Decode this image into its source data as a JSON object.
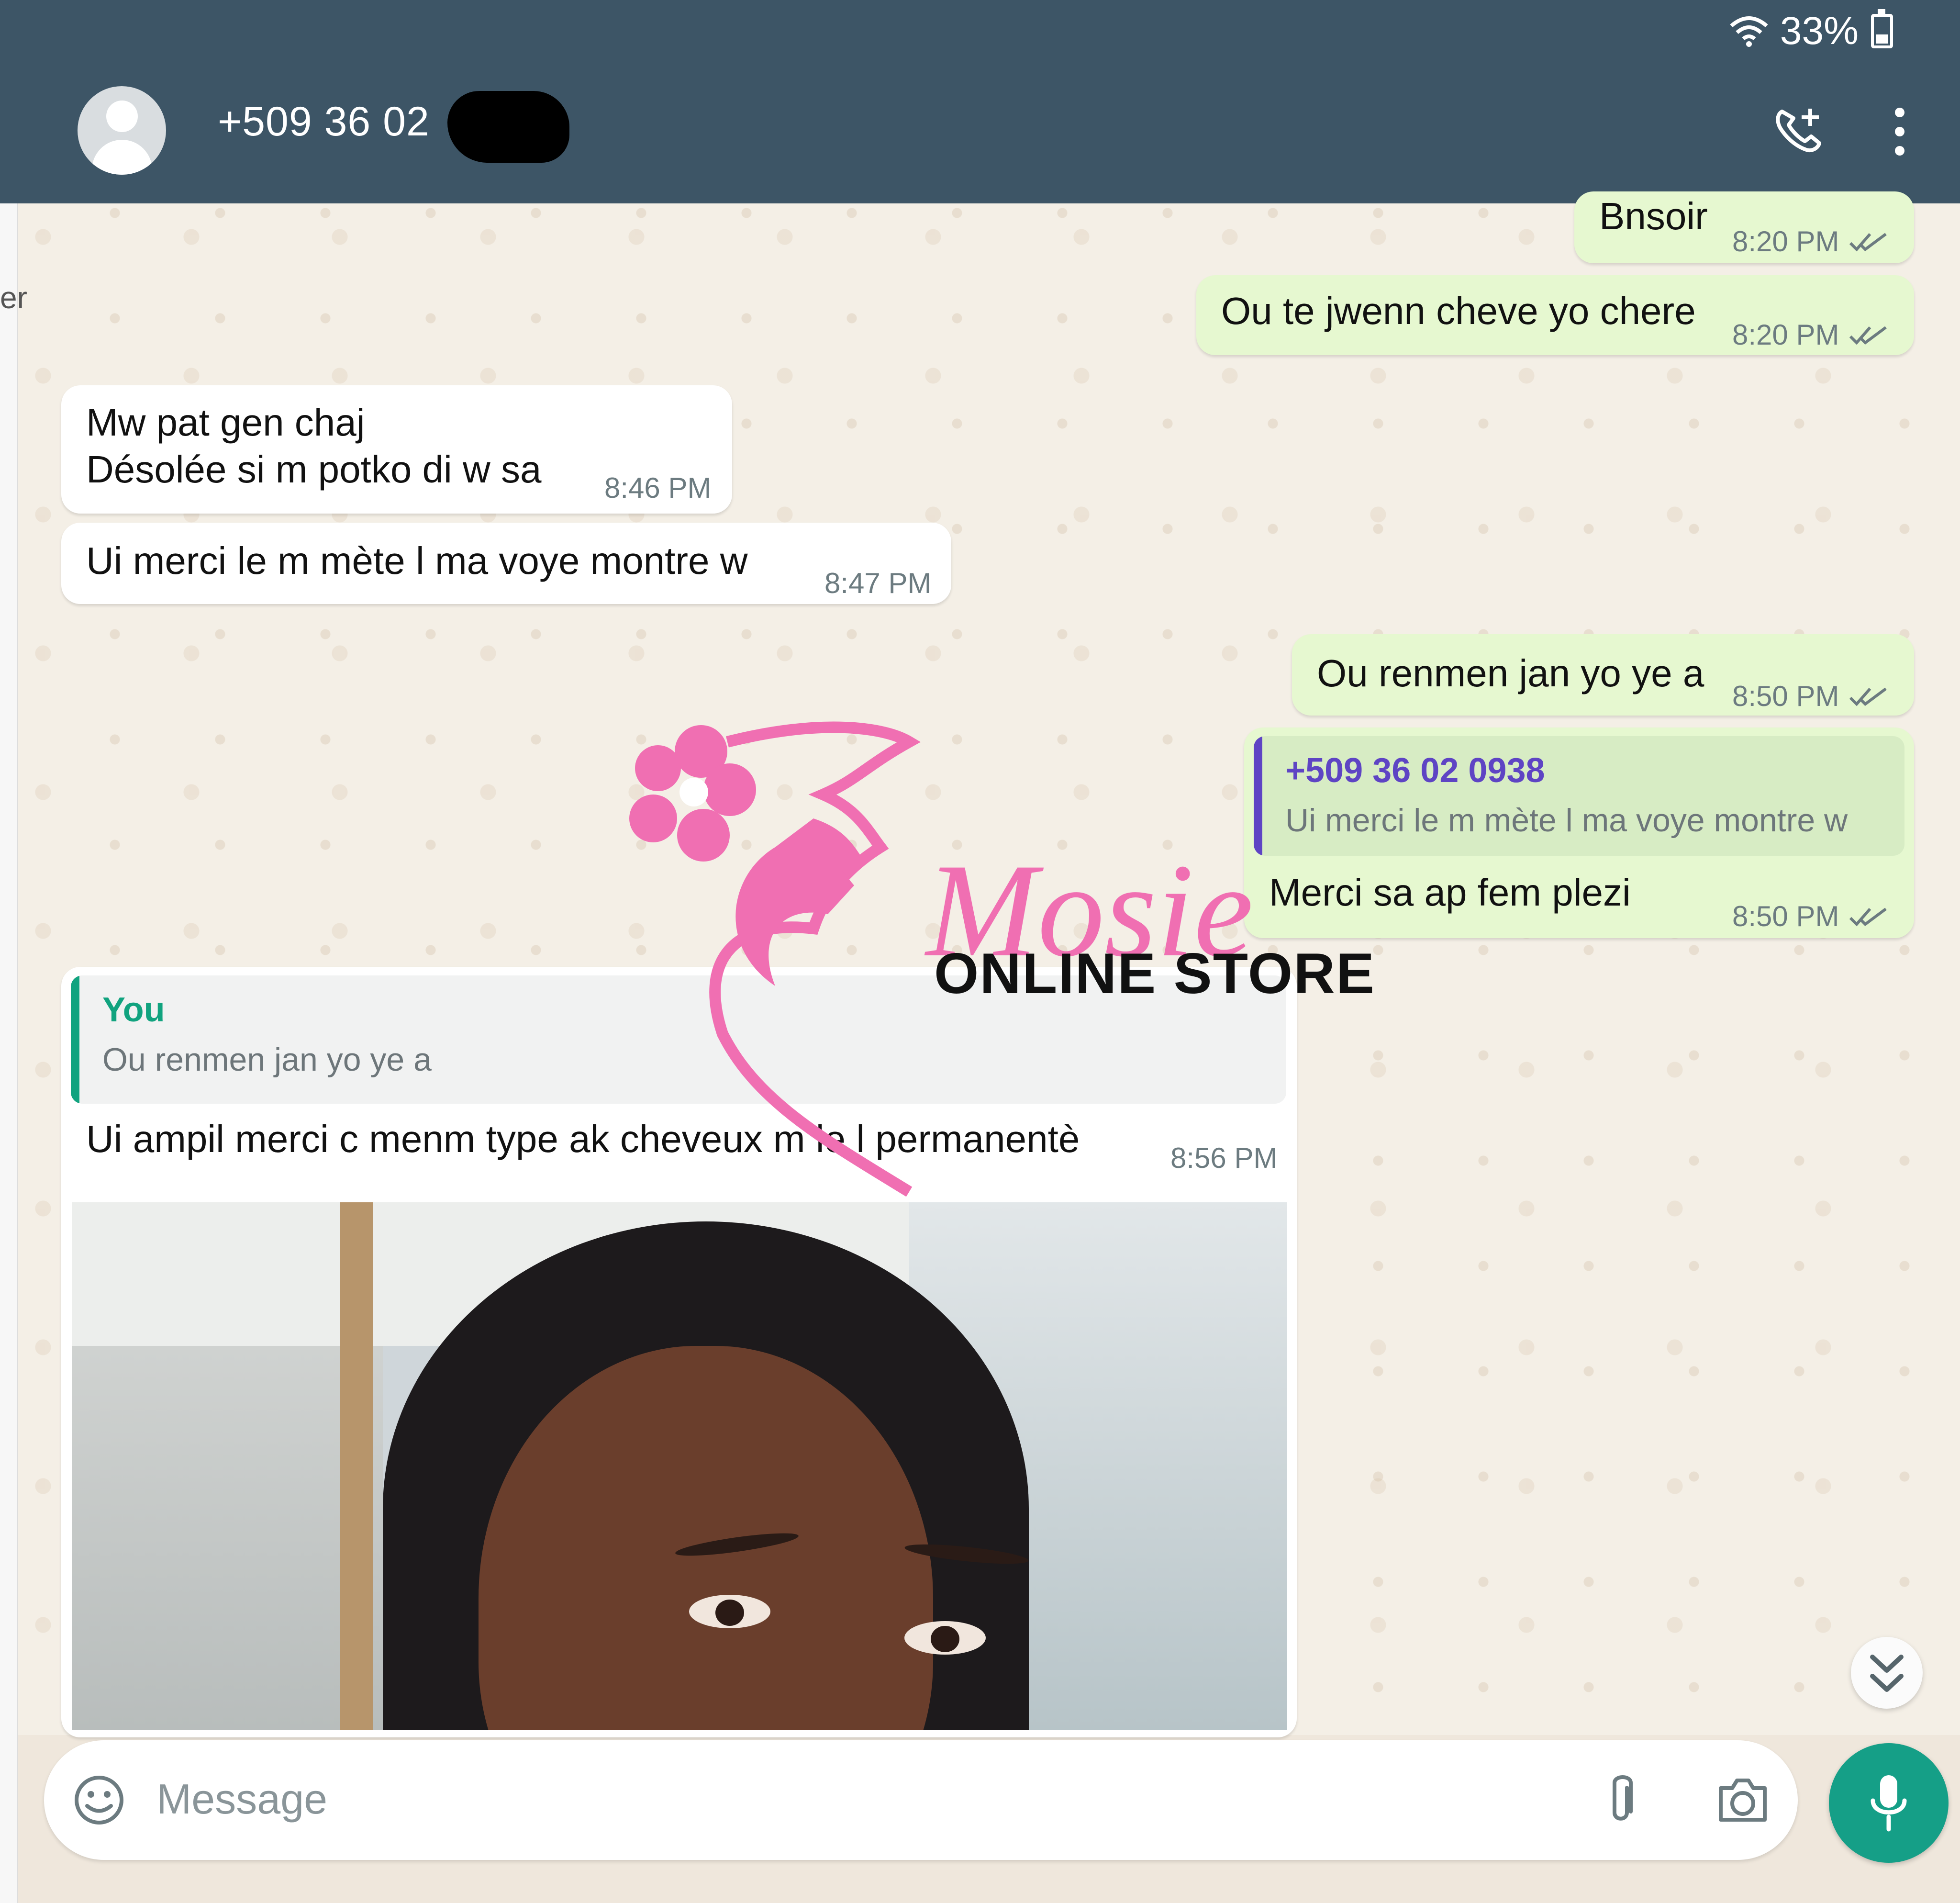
{
  "status": {
    "battery": "33%",
    "signal_icon": "wifi-icon",
    "battery_icon": "battery-icon"
  },
  "header": {
    "contact_name": "+509 36 02",
    "call_icon": "add-call-icon",
    "menu_icon": "more-vertical-icon"
  },
  "left_fragment": "er",
  "messages": [
    {
      "id": "m1",
      "direction": "outgoing",
      "text": "Bnsoir",
      "time": "8:20 PM",
      "status": "double-tick"
    },
    {
      "id": "m2",
      "direction": "outgoing",
      "text": "Ou te jwenn cheve yo chere",
      "time": "8:20 PM",
      "status": "double-tick"
    },
    {
      "id": "m3",
      "direction": "incoming",
      "text_line_1": "Mw pat gen chaj",
      "text_line_2": "Désolée si m potko di w sa",
      "time": "8:46 PM"
    },
    {
      "id": "m4",
      "direction": "incoming",
      "text": "Ui merci le m mète l ma voye montre w",
      "time": "8:47 PM"
    },
    {
      "id": "m5",
      "direction": "outgoing",
      "text": "Ou renmen jan yo ye a",
      "time": "8:50 PM",
      "status": "double-tick"
    },
    {
      "id": "m6",
      "direction": "outgoing",
      "quote_title": "+509 36 02 0938",
      "quote_text": "Ui merci le m mète l ma voye montre w",
      "text": "Merci sa ap fem plezi",
      "time": "8:50 PM",
      "status": "double-tick"
    },
    {
      "id": "m7",
      "direction": "incoming",
      "quote_title": "You",
      "quote_text": "Ou renmen jan yo ye a",
      "text": "Ui ampil merci c menm type ak cheveux m le l permanentè",
      "time": "8:56 PM"
    }
  ],
  "photo": {
    "description_icon": "selfie-photo"
  },
  "watermark": {
    "brand": "Mosie",
    "subtitle": "ONLINE STORE"
  },
  "composer": {
    "placeholder": "Message",
    "emoji_icon": "emoji-icon",
    "attach_icon": "paperclip-icon",
    "camera_icon": "camera-icon",
    "mic_icon": "microphone-icon"
  },
  "scroll_icon": "double-chevron-down-icon",
  "colors": {
    "header": "#3d5566",
    "outgoing": "#e6f8d0",
    "incoming": "#ffffff",
    "accent": "#159f87",
    "quote_out": "#5e44c4",
    "quote_in": "#11a37f",
    "watermark_pink": "#f06fb2"
  }
}
